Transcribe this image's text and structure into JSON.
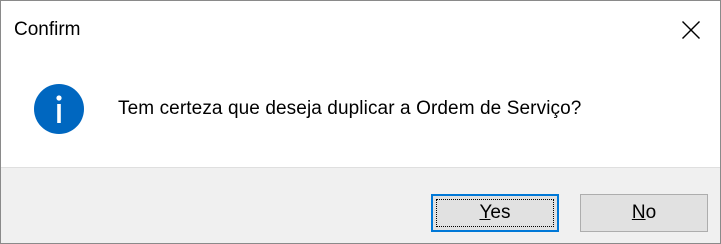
{
  "window": {
    "title": "Confirm",
    "close_icon": "close-icon"
  },
  "content": {
    "icon": "info-icon",
    "message": "Tem certeza que deseja duplicar a Ordem de Serviço?"
  },
  "buttons": {
    "yes": {
      "mnemonic": "Y",
      "rest": "es",
      "focused": true
    },
    "no": {
      "mnemonic": "N",
      "rest": "o",
      "focused": false
    }
  },
  "colors": {
    "info_blue": "#0067c0",
    "focus_border": "#0078d7",
    "footer_bg": "#f0f0f0",
    "button_bg": "#e1e1e1"
  }
}
